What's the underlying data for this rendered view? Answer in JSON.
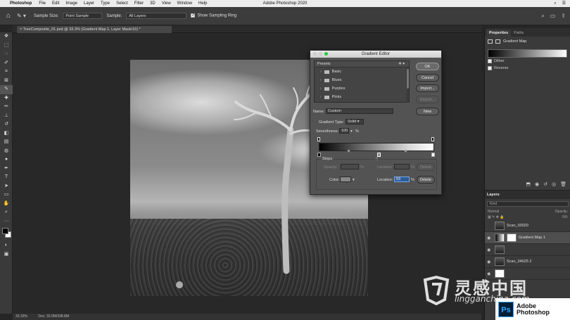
{
  "app": {
    "name": "Photoshop",
    "window_title": "Adobe Photoshop 2020"
  },
  "menu": [
    "File",
    "Edit",
    "Image",
    "Layer",
    "Type",
    "Select",
    "Filter",
    "3D",
    "View",
    "Window",
    "Help"
  ],
  "options_bar": {
    "sample_size_label": "Sample Size:",
    "sample_size_value": "Point Sample",
    "sample_label": "Sample:",
    "sample_value": "All Layers",
    "show_ring_label": "Show Sampling Ring",
    "show_ring_checked": true
  },
  "document": {
    "tab_title": "TreeComposite_01.psd @ 33.3% (Gradient Map 1, Layer Mask/16) *",
    "zoom": "33.33%",
    "doc_size": "Doc: 33.0M/338.8M"
  },
  "properties": {
    "tabs": [
      "Properties",
      "Paths"
    ],
    "title": "Gradient Map",
    "options": [
      "Dither",
      "Reverse"
    ]
  },
  "layers": {
    "header": "Layers",
    "filter_placeholder": "Kind",
    "blend_mode": "Normal",
    "opacity_label": "Opacity:",
    "fill_label": "Fill:",
    "items": [
      {
        "name": "Scan_00020",
        "visible": false,
        "selected": false
      },
      {
        "name": "Gradient Map 1",
        "visible": true,
        "selected": true
      },
      {
        "name": "",
        "visible": true,
        "selected": false
      },
      {
        "name": "Scan_04625 2",
        "visible": true,
        "selected": false
      },
      {
        "name": "",
        "visible": true,
        "selected": false
      }
    ]
  },
  "gradient_editor": {
    "title": "Gradient Editor",
    "presets_label": "Presets",
    "preset_folders": [
      "Basic",
      "Blues",
      "Purples",
      "Pinks"
    ],
    "buttons": {
      "ok": "OK",
      "cancel": "Cancel",
      "import": "Import...",
      "export": "Export...",
      "new": "New"
    },
    "name_label": "Name:",
    "name_value": "Custom",
    "gradient_type_label": "Gradient Type:",
    "gradient_type_value": "Solid",
    "smoothness_label": "Smoothness:",
    "smoothness_value": "100",
    "smoothness_unit": "%",
    "stops_label": "Stops",
    "opacity_label": "Opacity:",
    "location_label": "Location:",
    "delete_label": "Delete",
    "color_label": "Color:",
    "location_value": "53",
    "percent": "%"
  },
  "watermark": {
    "cn": "灵感中国",
    "domain": "lingganchina.com"
  },
  "ps_badge": {
    "ps": "Ps",
    "line1": "Adobe",
    "line2": "Photoshop"
  }
}
